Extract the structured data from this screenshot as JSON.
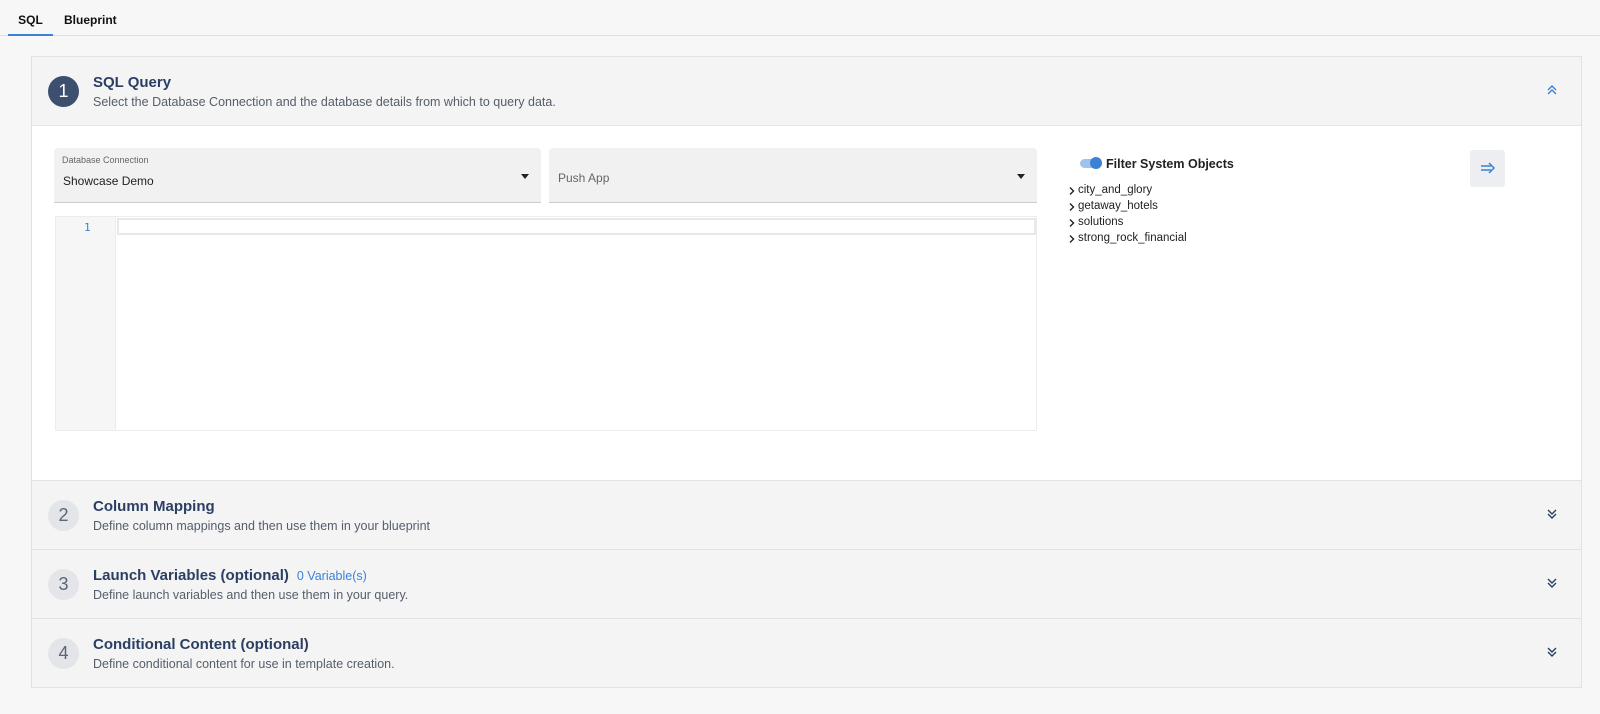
{
  "tabs": [
    {
      "label": "SQL",
      "active": true
    },
    {
      "label": "Blueprint",
      "active": false
    }
  ],
  "sections": [
    {
      "number": "1",
      "title": "SQL Query",
      "subtitle": "Select the Database Connection and the database details from which to query data.",
      "expanded": true
    },
    {
      "number": "2",
      "title": "Column Mapping",
      "subtitle": "Define column mappings and then use them in your blueprint",
      "expanded": false
    },
    {
      "number": "3",
      "title": "Launch Variables (optional)",
      "badge": "0 Variable(s)",
      "subtitle": "Define launch variables and then use them in your query.",
      "expanded": false
    },
    {
      "number": "4",
      "title": "Conditional Content (optional)",
      "subtitle": "Define conditional content for use in template creation.",
      "expanded": false
    }
  ],
  "query": {
    "db_label": "Database Connection",
    "db_value": "Showcase Demo",
    "app_placeholder": "Push App",
    "line_number": "1",
    "filter_label": "Filter System Objects",
    "filter_on": true,
    "schemas": [
      "city_and_glory",
      "getaway_hotels",
      "solutions",
      "strong_rock_financial"
    ]
  },
  "colors": {
    "accent": "#3b82d6",
    "title": "#2b3f63",
    "step_active": "#3d4f6e"
  }
}
